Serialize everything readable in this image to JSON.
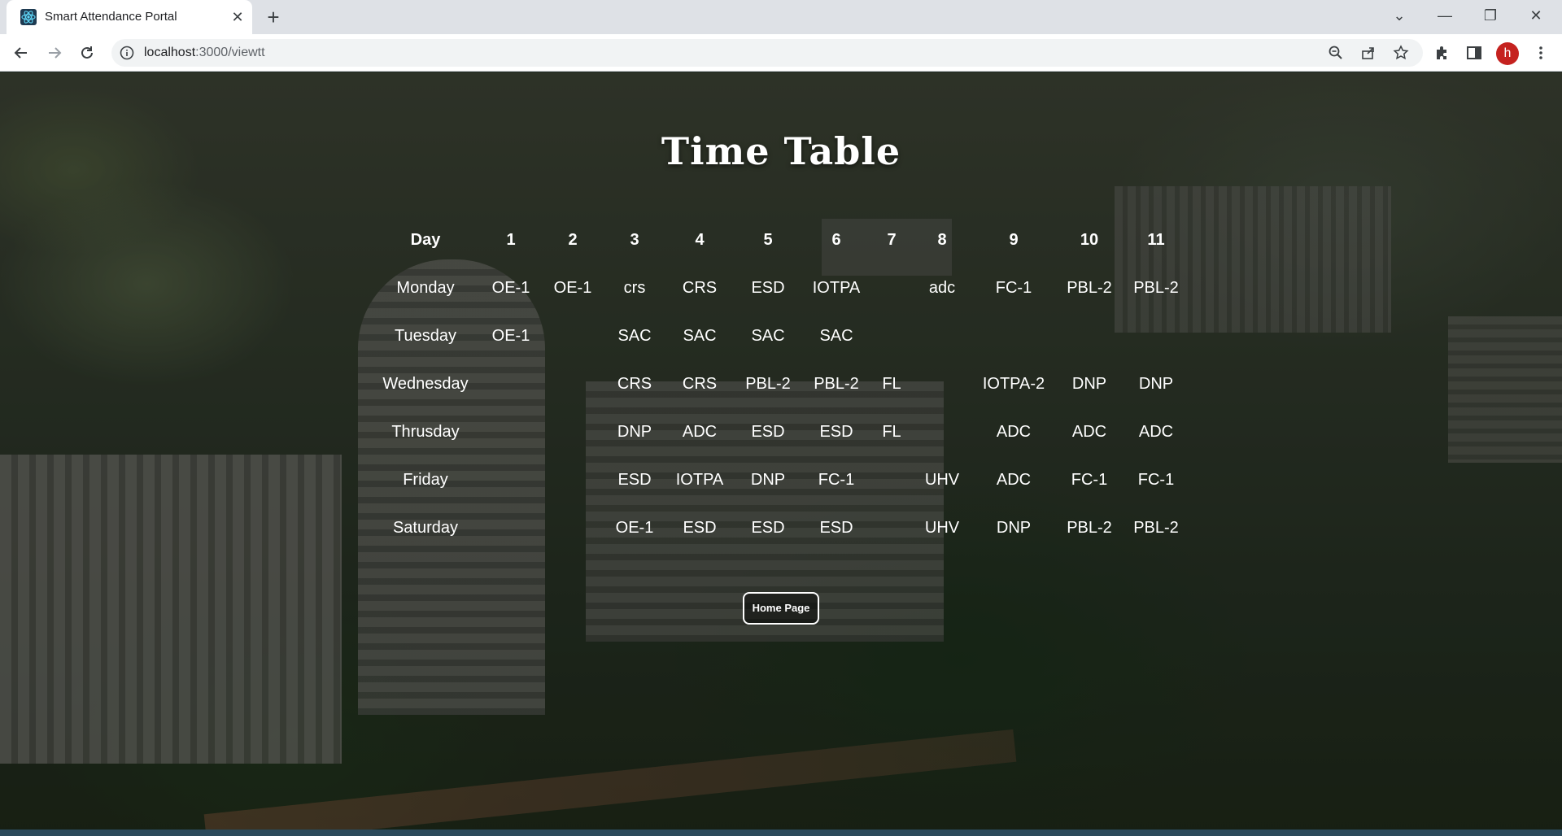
{
  "browser": {
    "tab_title": "Smart Attendance Portal",
    "tab_close": "✕",
    "new_tab": "+",
    "url_host": "localhost",
    "url_path": ":3000/viewtt",
    "profile_initial": "h",
    "window_controls": {
      "tab_search": "⌄",
      "minimize": "—",
      "restore": "❐",
      "close": "✕"
    }
  },
  "page": {
    "title": "Time Table",
    "table": {
      "header": [
        "Day",
        "1",
        "2",
        "3",
        "4",
        "5",
        "6",
        "7",
        "8",
        "9",
        "10",
        "11"
      ],
      "rows": [
        [
          "Monday",
          "OE-1",
          "OE-1",
          "crs",
          "CRS",
          "ESD",
          "IOTPA",
          "",
          "adc",
          "FC-1",
          "PBL-2",
          "PBL-2"
        ],
        [
          "Tuesday",
          "OE-1",
          "",
          "SAC",
          "SAC",
          "SAC",
          "SAC",
          "",
          "",
          "",
          "",
          ""
        ],
        [
          "Wednesday",
          "",
          "",
          "CRS",
          "CRS",
          "PBL-2",
          "PBL-2",
          "FL",
          "",
          "IOTPA-2",
          "DNP",
          "DNP"
        ],
        [
          "Thrusday",
          "",
          "",
          "DNP",
          "ADC",
          "ESD",
          "ESD",
          "FL",
          "",
          "ADC",
          "ADC",
          "ADC"
        ],
        [
          "Friday",
          "",
          "",
          "ESD",
          "IOTPA",
          "DNP",
          "FC-1",
          "",
          "UHV",
          "ADC",
          "FC-1",
          "FC-1"
        ],
        [
          "Saturday",
          "",
          "",
          "OE-1",
          "ESD",
          "ESD",
          "ESD",
          "",
          "UHV",
          "DNP",
          "PBL-2",
          "PBL-2"
        ]
      ]
    },
    "home_button": "Home Page"
  },
  "colors": {
    "tabbar_bg": "#dee1e6",
    "profile_avatar": "#c5221f",
    "text_on_page": "#ffffff"
  }
}
